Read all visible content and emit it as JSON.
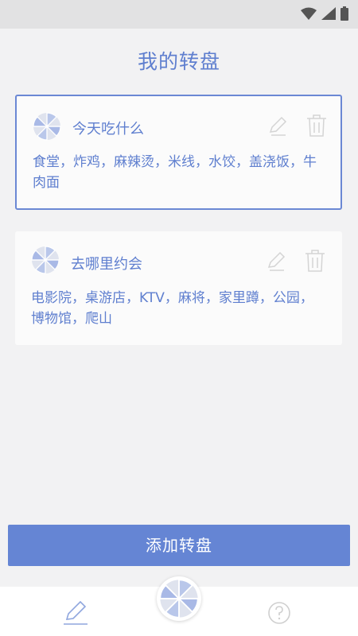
{
  "page": {
    "title": "我的转盘"
  },
  "wheels": [
    {
      "title": "今天吃什么",
      "options": "食堂，炸鸡，麻辣烫，米线，水饺，盖浇饭，牛肉面",
      "selected": true
    },
    {
      "title": "去哪里约会",
      "options": "电影院，桌游店，KTV，麻将，家里蹲，公园，博物馆，爬山",
      "selected": false
    }
  ],
  "actions": {
    "add_label": "添加转盘"
  },
  "colors": {
    "accent": "#6585d4",
    "text": "#5f7fcf",
    "background": "#f2f2f3",
    "icon_muted": "#d6d6d6"
  },
  "icons": {
    "status": [
      "wifi-icon",
      "signal-icon",
      "battery-icon"
    ],
    "card": [
      "wheel-icon",
      "edit-icon",
      "delete-icon"
    ],
    "nav": [
      "edit-icon",
      "wheel-icon",
      "help-icon"
    ]
  }
}
